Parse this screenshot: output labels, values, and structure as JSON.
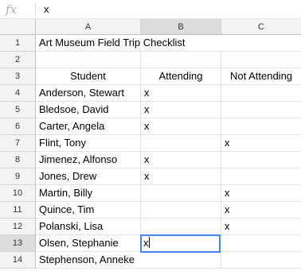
{
  "formula_bar": {
    "icon": "fx-icon",
    "value": "x"
  },
  "columns": [
    "A",
    "B",
    "C"
  ],
  "selected_column": "B",
  "selected_row": "13",
  "colors": {
    "active_cell_border": "#4285f4",
    "header_background": "#f3f3f3",
    "selected_header_background": "#dcdcdc"
  },
  "rows": [
    {
      "num": "1",
      "a": "Art Museum Field Trip Checklist",
      "b": "",
      "c": ""
    },
    {
      "num": "2",
      "a": "",
      "b": "",
      "c": ""
    },
    {
      "num": "3",
      "a": "Student",
      "b": "Attending",
      "c": "Not Attending"
    },
    {
      "num": "4",
      "a": "Anderson, Stewart",
      "b": "x",
      "c": ""
    },
    {
      "num": "5",
      "a": "Bledsoe, David",
      "b": "x",
      "c": ""
    },
    {
      "num": "6",
      "a": "Carter, Angela",
      "b": "x",
      "c": ""
    },
    {
      "num": "7",
      "a": "Flint, Tony",
      "b": "",
      "c": "x"
    },
    {
      "num": "8",
      "a": "Jimenez, Alfonso",
      "b": "x",
      "c": ""
    },
    {
      "num": "9",
      "a": "Jones, Drew",
      "b": "x",
      "c": ""
    },
    {
      "num": "10",
      "a": "Martin, Billy",
      "b": "",
      "c": "x"
    },
    {
      "num": "11",
      "a": "Quince, Tim",
      "b": "",
      "c": "x"
    },
    {
      "num": "12",
      "a": "Polanski, Lisa",
      "b": "",
      "c": "x"
    },
    {
      "num": "13",
      "a": "Olsen, Stephanie",
      "b": "x",
      "c": ""
    },
    {
      "num": "14",
      "a": "Stephenson, Anneke",
      "b": "",
      "c": ""
    }
  ]
}
